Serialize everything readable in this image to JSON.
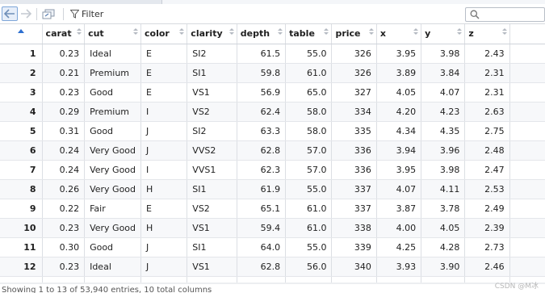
{
  "toolbar": {
    "filter_label": "Filter",
    "search_placeholder": ""
  },
  "table": {
    "columns": [
      "carat",
      "cut",
      "color",
      "clarity",
      "depth",
      "table",
      "price",
      "x",
      "y",
      "z"
    ],
    "rows": [
      {
        "idx": "1",
        "cells": [
          "0.23",
          "Ideal",
          "E",
          "SI2",
          "61.5",
          "55.0",
          "326",
          "3.95",
          "3.98",
          "2.43"
        ]
      },
      {
        "idx": "2",
        "cells": [
          "0.21",
          "Premium",
          "E",
          "SI1",
          "59.8",
          "61.0",
          "326",
          "3.89",
          "3.84",
          "2.31"
        ]
      },
      {
        "idx": "3",
        "cells": [
          "0.23",
          "Good",
          "E",
          "VS1",
          "56.9",
          "65.0",
          "327",
          "4.05",
          "4.07",
          "2.31"
        ]
      },
      {
        "idx": "4",
        "cells": [
          "0.29",
          "Premium",
          "I",
          "VS2",
          "62.4",
          "58.0",
          "334",
          "4.20",
          "4.23",
          "2.63"
        ]
      },
      {
        "idx": "5",
        "cells": [
          "0.31",
          "Good",
          "J",
          "SI2",
          "63.3",
          "58.0",
          "335",
          "4.34",
          "4.35",
          "2.75"
        ]
      },
      {
        "idx": "6",
        "cells": [
          "0.24",
          "Very Good",
          "J",
          "VVS2",
          "62.8",
          "57.0",
          "336",
          "3.94",
          "3.96",
          "2.48"
        ]
      },
      {
        "idx": "7",
        "cells": [
          "0.24",
          "Very Good",
          "I",
          "VVS1",
          "62.3",
          "57.0",
          "336",
          "3.95",
          "3.98",
          "2.47"
        ]
      },
      {
        "idx": "8",
        "cells": [
          "0.26",
          "Very Good",
          "H",
          "SI1",
          "61.9",
          "55.0",
          "337",
          "4.07",
          "4.11",
          "2.53"
        ]
      },
      {
        "idx": "9",
        "cells": [
          "0.22",
          "Fair",
          "E",
          "VS2",
          "65.1",
          "61.0",
          "337",
          "3.87",
          "3.78",
          "2.49"
        ]
      },
      {
        "idx": "10",
        "cells": [
          "0.23",
          "Very Good",
          "H",
          "VS1",
          "59.4",
          "61.0",
          "338",
          "4.00",
          "4.05",
          "2.39"
        ]
      },
      {
        "idx": "11",
        "cells": [
          "0.30",
          "Good",
          "J",
          "SI1",
          "64.0",
          "55.0",
          "339",
          "4.25",
          "4.28",
          "2.73"
        ]
      },
      {
        "idx": "12",
        "cells": [
          "0.23",
          "Ideal",
          "J",
          "VS1",
          "62.8",
          "56.0",
          "340",
          "3.93",
          "3.90",
          "2.46"
        ]
      },
      {
        "idx": "",
        "cells": [
          "",
          "",
          "",
          "",
          "",
          "",
          "",
          "",
          "",
          ""
        ]
      }
    ]
  },
  "status": {
    "text": "Showing 1 to 13 of 53,940 entries, 10 total columns"
  },
  "watermark": "CSDN @M冰",
  "colors": {
    "accent": "#2d6fd0",
    "grid_line": "#dcdfe4"
  }
}
